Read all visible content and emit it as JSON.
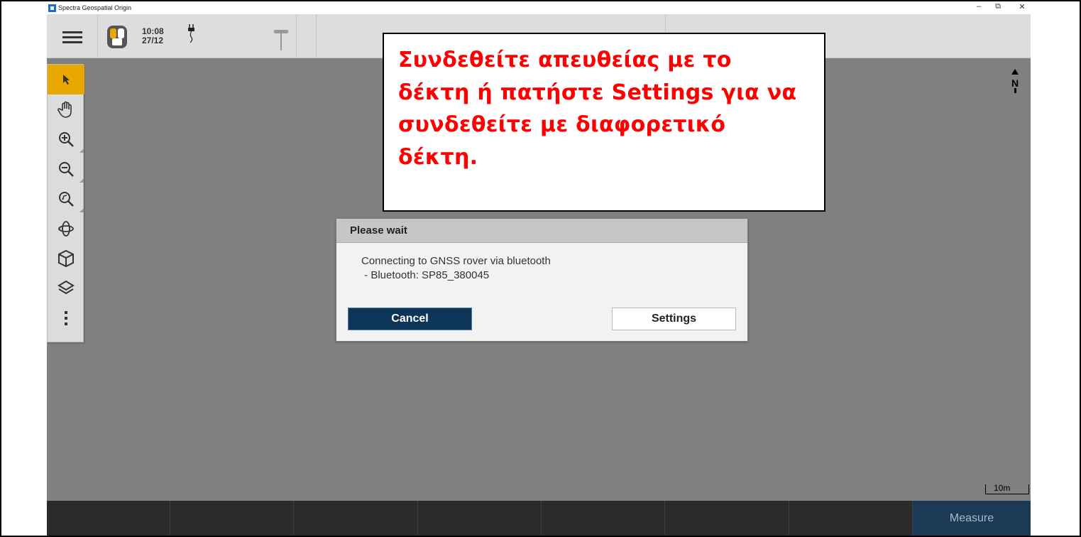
{
  "window": {
    "title": "Spectra Geospatial Origin",
    "controls": {
      "minimize": "–",
      "restore": "⧉",
      "close": "✕"
    }
  },
  "toolbar": {
    "menu_icon": "hamburger-icon",
    "receiver_icon": "gnss-receiver-icon",
    "time": "10:08",
    "date": "27/12",
    "power_icon": "power-plug-icon",
    "pole_icon": "survey-pole-icon"
  },
  "map_tools": [
    {
      "name": "select-arrow-icon",
      "active": true
    },
    {
      "name": "pan-hand-icon"
    },
    {
      "name": "zoom-in-icon"
    },
    {
      "name": "zoom-out-icon"
    },
    {
      "name": "zoom-extents-icon"
    },
    {
      "name": "orbit-icon"
    },
    {
      "name": "3d-cube-icon"
    },
    {
      "name": "layers-icon"
    },
    {
      "name": "more-vertical-icon"
    }
  ],
  "map": {
    "north_label": "N",
    "scale_label": "10m"
  },
  "callout": {
    "lines": [
      "Συνδεθείτε απευθείας με το",
      "δέκτη ή πατήστε Settings για να",
      "συνδεθείτε με διαφορετικό",
      "δέκτη."
    ],
    "color": "#ff0000"
  },
  "dialog": {
    "title": "Please wait",
    "message_line1": "Connecting to GNSS rover via bluetooth",
    "message_line2": " - Bluetooth: SP85_380045",
    "cancel_label": "Cancel",
    "settings_label": "Settings"
  },
  "bottombar": {
    "measure_label": "Measure"
  },
  "colors": {
    "map_background": "#808080",
    "active_tool": "#e8a800",
    "primary_button": "#0d3557",
    "bottom_bar": "#2b2b2b"
  }
}
